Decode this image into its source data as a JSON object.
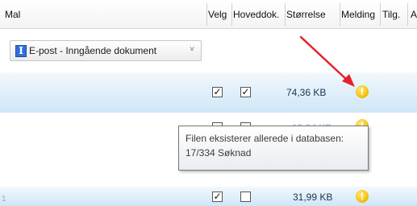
{
  "columns": {
    "mal": "Mal",
    "velg": "Velg",
    "hoveddok": "Hoveddok.",
    "storrelse": "Størrelse",
    "melding": "Melding",
    "tilg": "Tilg.",
    "cut": "A"
  },
  "template_dropdown": {
    "icon": "document-type-icon",
    "value": "E-post - Inngående dokument",
    "chevron": "˅"
  },
  "rows": [
    {
      "velg": true,
      "hoveddok": true,
      "size": "74,36 KB",
      "message_icon": "warning-icon"
    },
    {
      "velg": false,
      "hoveddok": false,
      "size": "15,84 KB",
      "message_icon": "warning-icon"
    },
    {
      "velg": false,
      "hoveddok": false,
      "size": "",
      "message_icon": "warning-icon"
    },
    {
      "row_number": "1",
      "velg": true,
      "hoveddok": false,
      "size": "31,99 KB",
      "message_icon": "warning-icon"
    }
  ],
  "tooltip": {
    "line1": "Filen eksisterer allerede i databasen:",
    "line2": "17/334 Søknad"
  },
  "annotation": {
    "arrow_color": "#e8202a"
  },
  "colors": {
    "selected_row": "#cfe6f7",
    "warning": "#f4c20d"
  }
}
